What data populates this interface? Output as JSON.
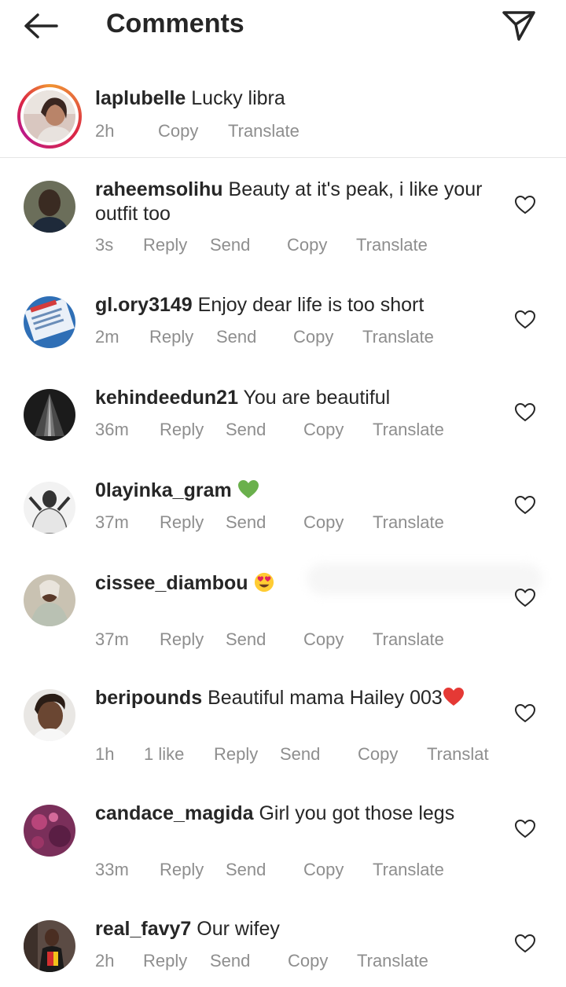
{
  "header": {
    "title": "Comments"
  },
  "caption": {
    "username": "laplubelle",
    "text": "Lucky libra",
    "time": "2h",
    "copy": "Copy",
    "translate": "Translate"
  },
  "comments": [
    {
      "username": "raheemsolihu",
      "text": "Beauty at it's peak, i like your outfit too",
      "time": "3s",
      "reply": "Reply",
      "send": "Send",
      "copy": "Copy",
      "translate": "Translate"
    },
    {
      "username": "gl.ory3149",
      "text": "Enjoy dear life is too short",
      "time": "2m",
      "reply": "Reply",
      "send": "Send",
      "copy": "Copy",
      "translate": "Translate"
    },
    {
      "username": "kehindeedun21",
      "text": "You are beautiful",
      "time": "36m",
      "reply": "Reply",
      "send": "Send",
      "copy": "Copy",
      "translate": "Translate"
    },
    {
      "username": "0layinka_gram",
      "text": "",
      "emoji": "green-heart",
      "time": "37m",
      "reply": "Reply",
      "send": "Send",
      "copy": "Copy",
      "translate": "Translate"
    },
    {
      "username": "cissee_diambou",
      "text": "",
      "emoji": "heart-eyes",
      "time": "37m",
      "reply": "Reply",
      "send": "Send",
      "copy": "Copy",
      "translate": "Translate"
    },
    {
      "username": "beripounds",
      "text": "Beautiful mama Hailey 003",
      "emoji": "red-heart",
      "time": "1h",
      "likes": "1 like",
      "reply": "Reply",
      "send": "Send",
      "copy": "Copy",
      "translate": "Translat"
    },
    {
      "username": "candace_magida",
      "text": "Girl you got those legs",
      "time": "33m",
      "reply": "Reply",
      "send": "Send",
      "copy": "Copy",
      "translate": "Translate"
    },
    {
      "username": "real_favy7",
      "text": "Our wifey",
      "time": "2h",
      "reply": "Reply",
      "send": "Send",
      "copy": "Copy",
      "translate": "Translate"
    }
  ],
  "colors": {
    "text": "#262626",
    "meta": "#8e8e8e",
    "divider": "#e6e6e6",
    "heart_icon": "#262626"
  }
}
